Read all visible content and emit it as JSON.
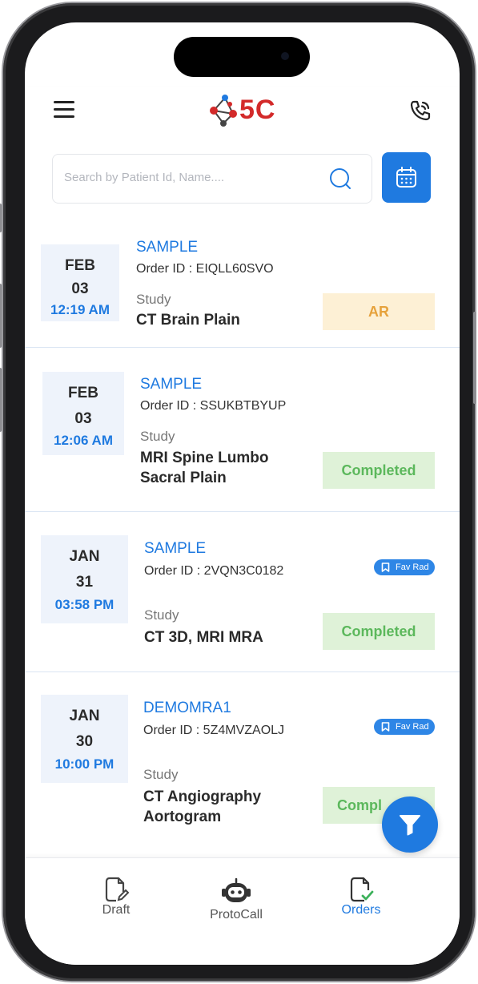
{
  "app": {
    "logo_text": "5C"
  },
  "search": {
    "placeholder": "Search by Patient Id, Name...."
  },
  "orders": [
    {
      "month": "FEB",
      "day": "03",
      "time": "12:19 AM",
      "patient": "SAMPLE",
      "order_id": "Order ID : EIQLL60SVO",
      "study_label": "Study",
      "study_lines": [
        "CT Brain Plain"
      ],
      "status": "AR",
      "status_type": "ar",
      "fav_rad": false
    },
    {
      "month": "FEB",
      "day": "03",
      "time": "12:06 AM",
      "patient": "SAMPLE",
      "order_id": "Order ID : SSUKBTBYUP",
      "study_label": "Study",
      "study_lines": [
        "MRI Spine Lumbo",
        "Sacral Plain"
      ],
      "status": "Completed",
      "status_type": "completed",
      "fav_rad": false
    },
    {
      "month": "JAN",
      "day": "31",
      "time": "03:58 PM",
      "patient": "SAMPLE",
      "order_id": "Order ID : 2VQN3C0182",
      "study_label": "Study",
      "study_lines": [
        "CT 3D, MRI MRA"
      ],
      "status": "Completed",
      "status_type": "completed",
      "fav_rad": true,
      "fav_label": "Fav Rad"
    },
    {
      "month": "JAN",
      "day": "30",
      "time": "10:00 PM",
      "patient": "DEMOMRA1",
      "order_id": "Order ID : 5Z4MVZAOLJ",
      "study_label": "Study",
      "study_lines": [
        "CT Angiography",
        "Aortogram"
      ],
      "status": "Compl",
      "status_type": "completed",
      "fav_rad": true,
      "fav_label": "Fav Rad"
    }
  ],
  "bottom_nav": [
    {
      "label": "Draft",
      "icon": "draft-icon",
      "active": false
    },
    {
      "label": "ProtoCall",
      "icon": "robot-icon",
      "active": false
    },
    {
      "label": "Orders",
      "icon": "orders-icon",
      "active": true
    }
  ],
  "colors": {
    "accent": "#1f7ae0",
    "brand_red": "#d32a2a",
    "ar_bg": "#fdf0d5",
    "ar_text": "#e6a23c",
    "done_bg": "#dff2d8",
    "done_text": "#5cb85c"
  }
}
